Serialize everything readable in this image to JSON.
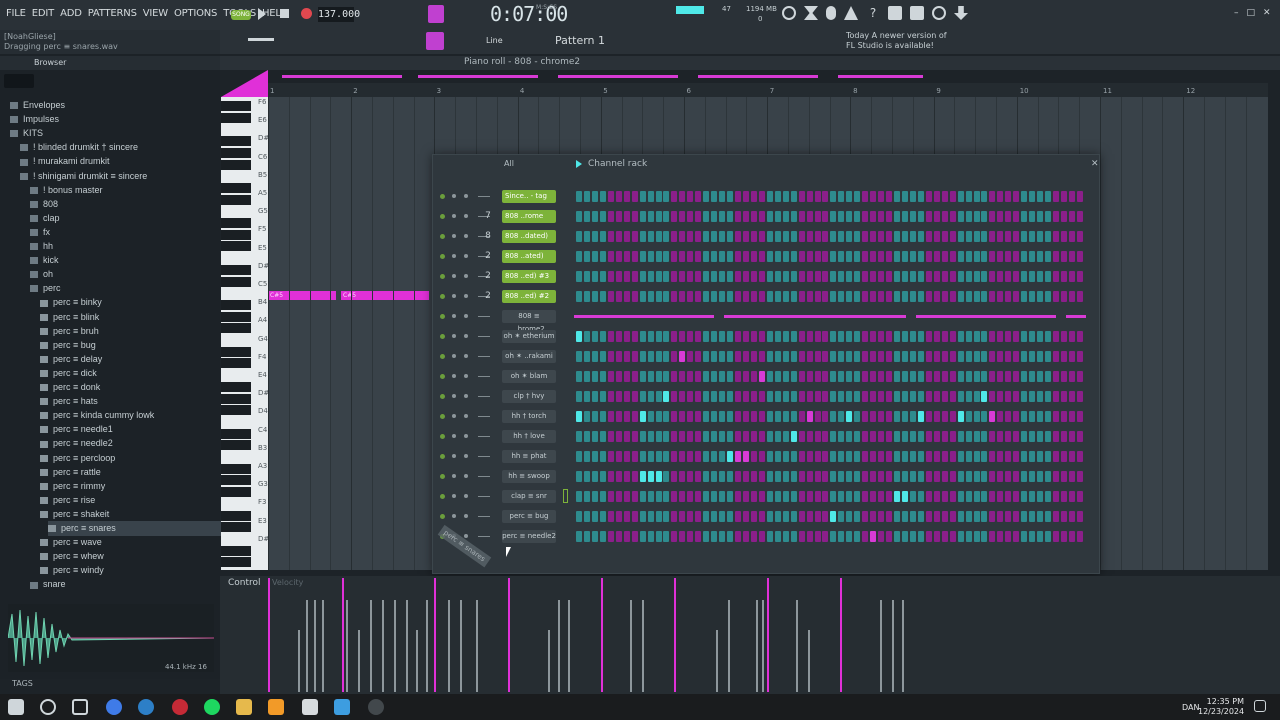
{
  "menu": [
    "FILE",
    "EDIT",
    "ADD",
    "PATTERNS",
    "VIEW",
    "OPTIONS",
    "TOOLS",
    "HELP"
  ],
  "transport": {
    "bpm": "137.000",
    "time": "0:07:00",
    "time_unit": "M:S:CS",
    "song_mode": "SONG",
    "cpu_mem": "1194 MB",
    "cpu_num": "47",
    "voices": "0"
  },
  "hint": {
    "user": "[NoahGliese]",
    "message": "Dragging perc ≡ snares.wav"
  },
  "toolbar": {
    "snap": "Line",
    "pattern": "Pattern 1"
  },
  "notice": {
    "line1": "Today  A newer version of",
    "line2": "FL Studio is available!"
  },
  "browser": {
    "title": "Browser",
    "items": [
      {
        "label": "Envelopes",
        "type": "folder",
        "indent": 0
      },
      {
        "label": "Impulses",
        "type": "folder",
        "indent": 0
      },
      {
        "label": "KITS",
        "type": "folder",
        "indent": 0
      },
      {
        "label": "! blinded drumkit † sincere",
        "type": "folder",
        "indent": 1
      },
      {
        "label": "! murakami drumkit",
        "type": "folder",
        "indent": 1
      },
      {
        "label": "! shinigami drumkit ≡ sincere",
        "type": "folder",
        "indent": 1
      },
      {
        "label": "! bonus master",
        "type": "folder",
        "indent": 2
      },
      {
        "label": "808",
        "type": "folder",
        "indent": 2
      },
      {
        "label": "clap",
        "type": "folder",
        "indent": 2
      },
      {
        "label": "fx",
        "type": "folder",
        "indent": 2
      },
      {
        "label": "hh",
        "type": "folder",
        "indent": 2
      },
      {
        "label": "kick",
        "type": "folder",
        "indent": 2
      },
      {
        "label": "oh",
        "type": "folder",
        "indent": 2
      },
      {
        "label": "perc",
        "type": "folder",
        "indent": 2
      },
      {
        "label": "perc ≡ binky",
        "type": "file",
        "indent": 3
      },
      {
        "label": "perc ≡ blink",
        "type": "file",
        "indent": 3
      },
      {
        "label": "perc ≡ bruh",
        "type": "file",
        "indent": 3
      },
      {
        "label": "perc ≡ bug",
        "type": "file",
        "indent": 3
      },
      {
        "label": "perc ≡ delay",
        "type": "file",
        "indent": 3
      },
      {
        "label": "perc ≡ dick",
        "type": "file",
        "indent": 3
      },
      {
        "label": "perc ≡ donk",
        "type": "file",
        "indent": 3
      },
      {
        "label": "perc ≡ hats",
        "type": "file",
        "indent": 3
      },
      {
        "label": "perc ≡ kinda cummy lowk",
        "type": "file",
        "indent": 3
      },
      {
        "label": "perc ≡ needle1",
        "type": "file",
        "indent": 3
      },
      {
        "label": "perc ≡ needle2",
        "type": "file",
        "indent": 3
      },
      {
        "label": "perc ≡ percloop",
        "type": "file",
        "indent": 3
      },
      {
        "label": "perc ≡ rattle",
        "type": "file",
        "indent": 3
      },
      {
        "label": "perc ≡ rimmy",
        "type": "file",
        "indent": 3
      },
      {
        "label": "perc ≡ rise",
        "type": "file",
        "indent": 3
      },
      {
        "label": "perc ≡ shakeit",
        "type": "file",
        "indent": 3
      },
      {
        "label": "perc ≡ snares",
        "type": "file",
        "indent": 3,
        "selected": true
      },
      {
        "label": "perc ≡ wave",
        "type": "file",
        "indent": 3
      },
      {
        "label": "perc ≡ whew",
        "type": "file",
        "indent": 3
      },
      {
        "label": "perc ≡ windy",
        "type": "file",
        "indent": 3
      },
      {
        "label": "snare",
        "type": "folder",
        "indent": 2
      }
    ],
    "wave_info": "44.1 kHz 16",
    "tags_label": "TAGS"
  },
  "piano_roll": {
    "title": "Piano roll - 808 - chrome2",
    "bars": [
      "1",
      "2",
      "3",
      "4",
      "5",
      "6",
      "7",
      "8",
      "9",
      "10",
      "11",
      "12"
    ],
    "key_labels": [
      "F6",
      "E6",
      "D#6",
      "C6",
      "B5",
      "A5",
      "G5",
      "F5",
      "E5",
      "D#5",
      "C5",
      "B4",
      "A4",
      "G4",
      "F4",
      "E4",
      "D#4",
      "D4",
      "C4",
      "B3",
      "A3",
      "G3",
      "F3",
      "E3",
      "D#3"
    ],
    "notes": [
      {
        "label": "C#5"
      },
      {
        "label": "C#5"
      }
    ]
  },
  "channel_rack": {
    "title": "Channel rack",
    "filter": "All",
    "channels": [
      {
        "name": "Since.. - tag",
        "style": "green",
        "mixer": ""
      },
      {
        "name": "808 ..rome",
        "style": "green",
        "mixer": "7"
      },
      {
        "name": "808 ..dated)",
        "style": "green",
        "mixer": "8"
      },
      {
        "name": "808 ..ated)",
        "style": "green",
        "mixer": "2"
      },
      {
        "name": "808 ..ed) #3",
        "style": "green",
        "mixer": "2"
      },
      {
        "name": "808 ..ed) #2",
        "style": "green",
        "mixer": "2"
      },
      {
        "name": "808 ≡ ..hrome2",
        "style": "grey",
        "mixer": "",
        "piano": true
      },
      {
        "name": "oh ✶ etherium",
        "style": "grey",
        "mixer": ""
      },
      {
        "name": "oh ✶ ..rakami",
        "style": "grey",
        "mixer": ""
      },
      {
        "name": "oh ✶ blam",
        "style": "grey",
        "mixer": ""
      },
      {
        "name": "clp † hvy",
        "style": "grey",
        "mixer": ""
      },
      {
        "name": "hh † torch",
        "style": "grey",
        "mixer": ""
      },
      {
        "name": "hh † love",
        "style": "grey",
        "mixer": ""
      },
      {
        "name": "hh ≡ phat",
        "style": "grey",
        "mixer": ""
      },
      {
        "name": "hh ≡ swoop",
        "style": "grey",
        "mixer": ""
      },
      {
        "name": "clap ≡ snr",
        "style": "grey",
        "mixer": ""
      },
      {
        "name": "perc ≡ bug",
        "style": "grey",
        "mixer": ""
      },
      {
        "name": "perc ≡ needle2",
        "style": "grey",
        "mixer": ""
      }
    ]
  },
  "control": {
    "label": "Control",
    "sub": "Velocity"
  },
  "drag_ghost": "perc ≡ snares",
  "taskbar": {
    "lang": "DAN",
    "time": "12:35 PM",
    "date": "12/23/2024"
  },
  "colors": {
    "accent": "#d83bd6",
    "teal": "#2e8b8e",
    "green": "#7db33a"
  }
}
